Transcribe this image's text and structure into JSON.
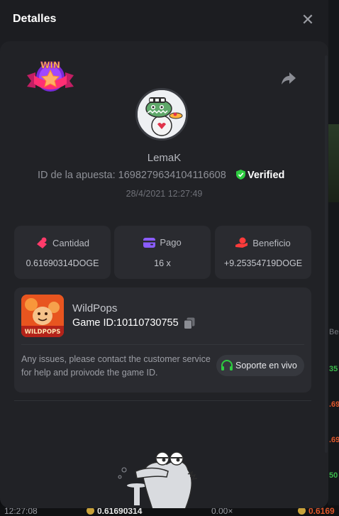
{
  "modal": {
    "title": "Detalles",
    "close_icon": "close-icon"
  },
  "bet": {
    "badge_text": "WIN",
    "username": "LemaK",
    "bet_id_label": "ID de la apuesta:",
    "bet_id": "1698279634104116608",
    "bet_id_full": "ID de la apuesta: 1698279634104116608",
    "verified_label": "Verified",
    "timestamp": "28/4/2021 12:27:49"
  },
  "stats": [
    {
      "label": "Cantidad",
      "value": "0.61690314DOGE",
      "icon": "coins-icon",
      "color": "#ff3b6a"
    },
    {
      "label": "Pago",
      "value": "16 x",
      "icon": "wallet-icon",
      "color": "#8a5cff"
    },
    {
      "label": "Beneficio",
      "value": "+9.25354719DOGE",
      "icon": "hand-coin-icon",
      "color": "#ff3b3b"
    }
  ],
  "game": {
    "name": "WildPops",
    "thumb_text": "WILDPOPS",
    "game_id_text": "Game ID:10110730755",
    "support_text": "Any issues, please contact the customer service for help and proivode the game ID.",
    "support_button": "Soporte en vivo"
  },
  "background": {
    "right_fragments": [
      "Be",
      "35",
      ".69",
      ".69",
      ".69",
      "50"
    ],
    "bottom_time": "12:27:08",
    "bottom_amount": "0.61690314",
    "bottom_payout": "0.00×",
    "bottom_right": "0.6169"
  },
  "colors": {
    "verified_shield": "#2ecc40",
    "headset": "#2ecc40",
    "accent_red": "#e02a3a"
  }
}
